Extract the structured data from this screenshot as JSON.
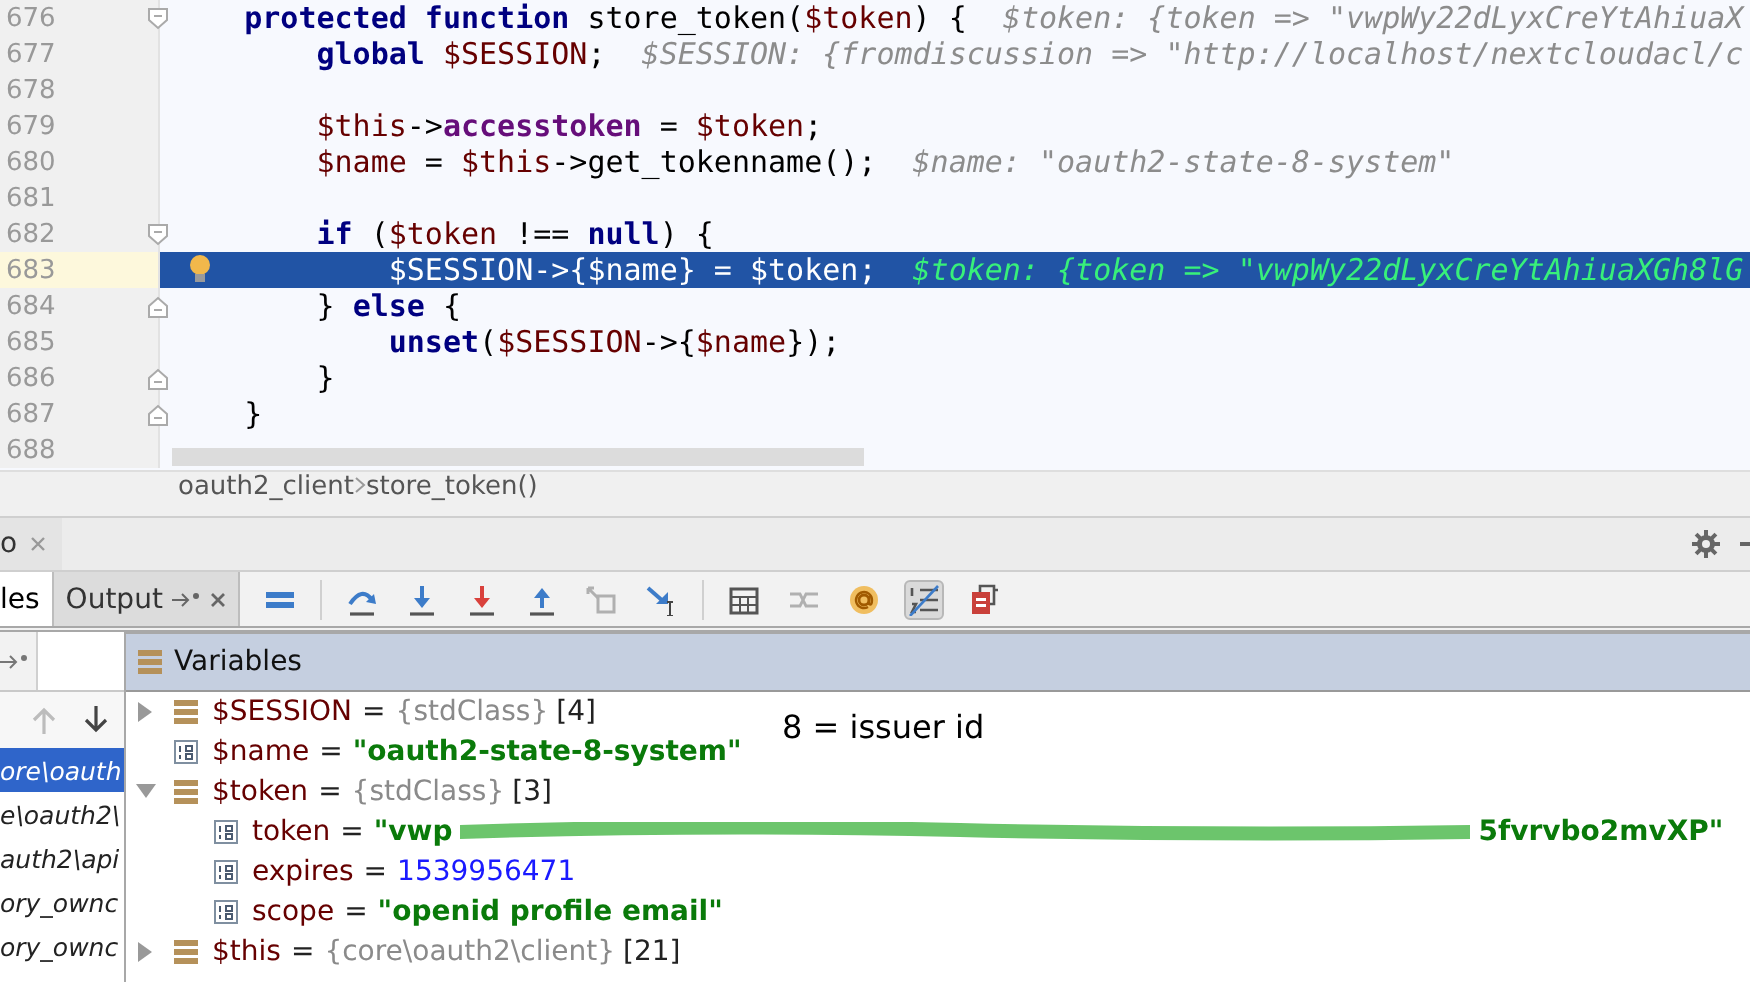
{
  "editor": {
    "lines": [
      {
        "number": "676",
        "fold_start": true,
        "fold_end": false,
        "current": false,
        "tokens": [
          {
            "kind": "keyword",
            "text": "    protected"
          },
          {
            "kind": "keyword",
            "text": " function"
          },
          {
            "kind": "plain",
            "text": " store_token("
          },
          {
            "kind": "var",
            "text": "$token"
          },
          {
            "kind": "plain",
            "text": ") {"
          }
        ],
        "hint": "$token: {token => \"vwpWy22dLyxCreYtAhiuaX"
      },
      {
        "number": "677",
        "fold_start": false,
        "fold_end": false,
        "current": false,
        "tokens": [
          {
            "kind": "keyword",
            "text": "        global"
          },
          {
            "kind": "var",
            "text": " $SESSION"
          },
          {
            "kind": "plain",
            "text": ";"
          }
        ],
        "hint": "$SESSION: {fromdiscussion => \"http://localhost/nextcloudacl/c"
      },
      {
        "number": "678",
        "fold_start": false,
        "fold_end": false,
        "current": false
      },
      {
        "number": "679",
        "fold_start": false,
        "fold_end": false,
        "current": false,
        "tokens": [
          {
            "kind": "var",
            "text": "        $this"
          },
          {
            "kind": "plain",
            "text": "->"
          },
          {
            "kind": "field",
            "text": "accesstoken"
          },
          {
            "kind": "plain",
            "text": " = "
          },
          {
            "kind": "var",
            "text": "$token"
          },
          {
            "kind": "plain",
            "text": ";"
          }
        ]
      },
      {
        "number": "680",
        "fold_start": false,
        "fold_end": false,
        "current": false,
        "tokens": [
          {
            "kind": "var",
            "text": "        $name"
          },
          {
            "kind": "plain",
            "text": " = "
          },
          {
            "kind": "var",
            "text": "$this"
          },
          {
            "kind": "plain",
            "text": "->get_tokenname();"
          }
        ],
        "hint": "$name: \"oauth2-state-8-system\""
      },
      {
        "number": "681",
        "fold_start": false,
        "fold_end": false,
        "current": false
      },
      {
        "number": "682",
        "fold_start": true,
        "fold_end": false,
        "current": false,
        "tokens": [
          {
            "kind": "keyword",
            "text": "        if"
          },
          {
            "kind": "plain",
            "text": " ("
          },
          {
            "kind": "var",
            "text": "$token"
          },
          {
            "kind": "plain",
            "text": " !== "
          },
          {
            "kind": "keyword",
            "text": "null"
          },
          {
            "kind": "plain",
            "text": ") {"
          }
        ]
      },
      {
        "number": "683",
        "fold_start": false,
        "fold_end": false,
        "current": true,
        "tokens": [
          {
            "kind": "var",
            "text": "            $SESSION"
          },
          {
            "kind": "plain",
            "text": "->{"
          },
          {
            "kind": "var",
            "text": "$name"
          },
          {
            "kind": "plain",
            "text": "} = "
          },
          {
            "kind": "var",
            "text": "$token"
          },
          {
            "kind": "plain",
            "text": ";"
          }
        ],
        "hint": "$token: {token => \"vwpWy22dLyxCreYtAhiuaXGh8lG"
      },
      {
        "number": "684",
        "fold_start": false,
        "fold_end": true,
        "current": false,
        "tokens": [
          {
            "kind": "plain",
            "text": "        } "
          },
          {
            "kind": "keyword",
            "text": "else"
          },
          {
            "kind": "plain",
            "text": " {"
          }
        ]
      },
      {
        "number": "685",
        "fold_start": false,
        "fold_end": false,
        "current": false,
        "tokens": [
          {
            "kind": "keyword",
            "text": "            unset"
          },
          {
            "kind": "plain",
            "text": "("
          },
          {
            "kind": "var",
            "text": "$SESSION"
          },
          {
            "kind": "plain",
            "text": "->{"
          },
          {
            "kind": "var",
            "text": "$name"
          },
          {
            "kind": "plain",
            "text": "});"
          }
        ]
      },
      {
        "number": "686",
        "fold_start": false,
        "fold_end": true,
        "current": false,
        "tokens": [
          {
            "kind": "plain",
            "text": "        }"
          }
        ]
      },
      {
        "number": "687",
        "fold_start": false,
        "fold_end": true,
        "current": false,
        "tokens": [
          {
            "kind": "plain",
            "text": "    }"
          }
        ]
      },
      {
        "number": "688",
        "fold_start": false,
        "fold_end": false,
        "current": false
      }
    ]
  },
  "breadcrumb": [
    "oauth2_client",
    "store_token()"
  ],
  "debug": {
    "tab": "o",
    "tabs": [
      {
        "label": "les",
        "selected": true
      },
      {
        "label": "Output",
        "selected": false
      }
    ],
    "toolbar": [
      {
        "buttons": [
          {
            "kind": "frames",
            "disabled": false,
            "pressed": false
          }
        ]
      },
      {
        "buttons": [
          {
            "kind": "step-over",
            "disabled": false,
            "pressed": false
          },
          {
            "kind": "step-into",
            "disabled": false,
            "pressed": false
          },
          {
            "kind": "force-step-into",
            "disabled": false,
            "pressed": false
          },
          {
            "kind": "step-out",
            "disabled": false,
            "pressed": false
          },
          {
            "kind": "drop-frame",
            "disabled": true,
            "pressed": false
          },
          {
            "kind": "run-to-cursor",
            "disabled": false,
            "pressed": false
          }
        ]
      },
      {
        "buttons": [
          {
            "kind": "evaluate",
            "disabled": false,
            "pressed": false
          },
          {
            "kind": "trace",
            "disabled": true,
            "pressed": false
          },
          {
            "kind": "watch",
            "disabled": false,
            "pressed": false
          },
          {
            "kind": "toggle-values",
            "disabled": false,
            "pressed": true
          },
          {
            "kind": "restore-layout",
            "disabled": false,
            "pressed": false
          }
        ]
      }
    ],
    "frame_nav": [
      {
        "kind": "up",
        "disabled": true
      },
      {
        "kind": "down",
        "disabled": false
      }
    ],
    "frames": [
      {
        "text": "ore\\oauth",
        "selected": true
      },
      {
        "text": "e\\oauth2\\",
        "selected": false
      },
      {
        "text": "auth2\\api",
        "selected": false
      },
      {
        "text": "ory_ownc",
        "selected": false
      },
      {
        "text": "ory_ownc",
        "selected": false
      }
    ],
    "variables": {
      "title": "Variables",
      "annotation": "8 = issuer id",
      "items": [
        {
          "name": "$SESSION",
          "sep": "=",
          "kind": "object",
          "type": "{stdClass}",
          "count": "[4]",
          "expanded": false
        },
        {
          "name": "$name",
          "sep": "=",
          "kind": "string",
          "value": "\"oauth2-state-8-system\""
        },
        {
          "name": "$token",
          "sep": "=",
          "kind": "object",
          "type": "{stdClass}",
          "count": "[3]",
          "expanded": true,
          "children": [
            {
              "name": "token",
              "sep": "=",
              "kind": "string",
              "value": "\"vwp",
              "value_end": "5fvrvbo2mvXP\"",
              "redacted": true
            },
            {
              "name": "expires",
              "sep": "=",
              "kind": "number",
              "value": "1539956471"
            },
            {
              "name": "scope",
              "sep": "=",
              "kind": "string",
              "value": "\"openid profile email\""
            }
          ]
        },
        {
          "name": "$this",
          "sep": "=",
          "kind": "object",
          "type": "{core\\oauth2\\client}",
          "count": "[21]",
          "expanded": false
        }
      ]
    }
  }
}
